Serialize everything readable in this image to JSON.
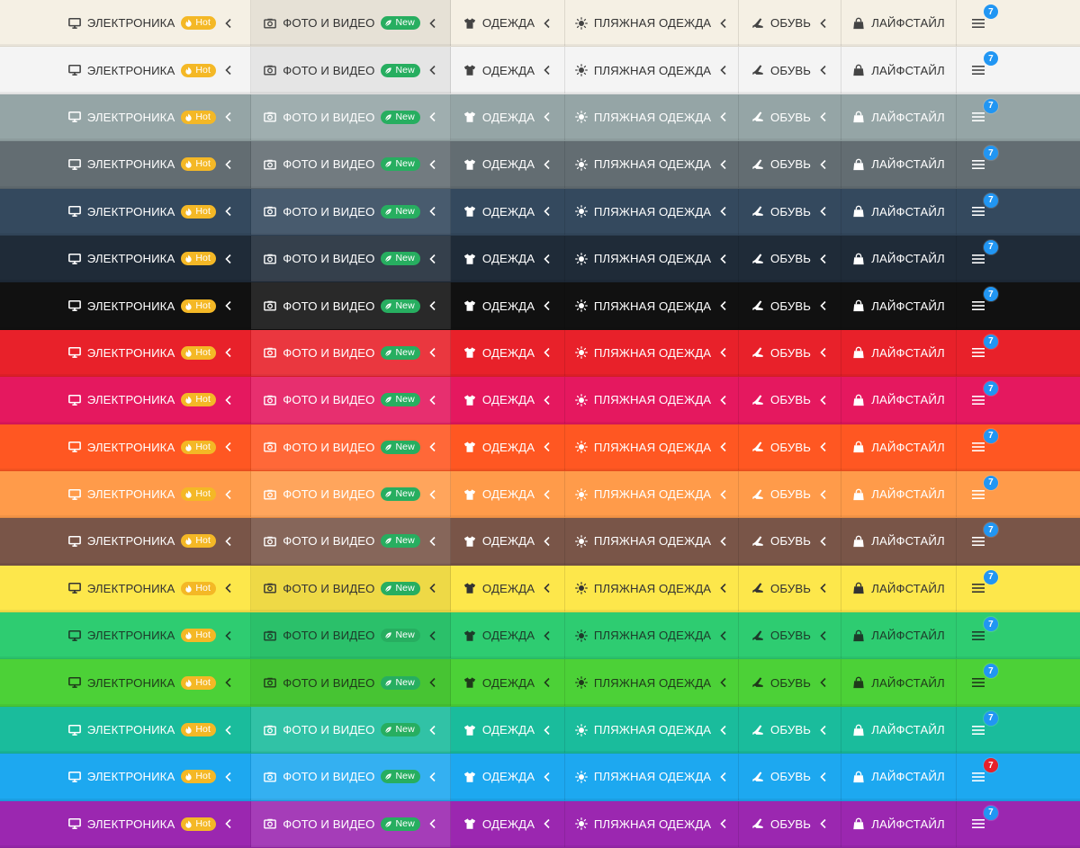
{
  "menu": {
    "items": [
      {
        "id": "elec",
        "label": "ЭЛЕКТРОНИКА",
        "icon": "monitor-icon",
        "badge": {
          "text": "Hot",
          "kind": "hot",
          "icon": "fire-icon"
        },
        "submenu": true
      },
      {
        "id": "foto",
        "label": "ФОТО И ВИДЕО",
        "icon": "camera-icon",
        "badge": {
          "text": "New",
          "kind": "new",
          "icon": "leaf-icon"
        },
        "submenu": true,
        "active": true
      },
      {
        "id": "odez",
        "label": "ОДЕЖДА",
        "icon": "tshirt-icon",
        "submenu": true
      },
      {
        "id": "plaj",
        "label": "ПЛЯЖНАЯ ОДЕЖДА",
        "icon": "sun-icon",
        "submenu": true
      },
      {
        "id": "obuv",
        "label": "ОБУВЬ",
        "icon": "high-heel-icon",
        "submenu": true
      },
      {
        "id": "life",
        "label": "ЛАЙФСТАЙЛ",
        "icon": "shopping-bag-icon",
        "submenu": false
      }
    ],
    "hamburger": {
      "icon": "hamburger-icon",
      "count": "7"
    }
  },
  "themes": [
    {
      "name": "cream",
      "bg": "#f5f0e4",
      "text": "#333333",
      "icon": "#444444",
      "tone": "light"
    },
    {
      "name": "white",
      "bg": "#f4f4f4",
      "text": "#333333",
      "icon": "#444444",
      "tone": "light"
    },
    {
      "name": "gray",
      "bg": "#95a5a6",
      "text": "#ffffff",
      "icon": "#ffffff",
      "tone": "dark"
    },
    {
      "name": "asbestos",
      "bg": "#636d72",
      "text": "#ffffff",
      "icon": "#ffffff",
      "tone": "dark"
    },
    {
      "name": "navy",
      "bg": "#34495e",
      "text": "#ffffff",
      "icon": "#ffffff",
      "tone": "dark"
    },
    {
      "name": "midnight",
      "bg": "#1f2b38",
      "text": "#ffffff",
      "icon": "#ffffff",
      "tone": "dark"
    },
    {
      "name": "black",
      "bg": "#111111",
      "text": "#ffffff",
      "icon": "#ffffff",
      "tone": "dark"
    },
    {
      "name": "red",
      "bg": "#e8212a",
      "text": "#ffffff",
      "icon": "#ffffff",
      "tone": "dark"
    },
    {
      "name": "pink",
      "bg": "#e5185f",
      "text": "#ffffff",
      "icon": "#ffffff",
      "tone": "dark"
    },
    {
      "name": "orange-red",
      "bg": "#ff5722",
      "text": "#ffffff",
      "icon": "#ffffff",
      "tone": "dark"
    },
    {
      "name": "orange",
      "bg": "#ff9b4a",
      "text": "#ffffff",
      "icon": "#ffffff",
      "tone": "dark"
    },
    {
      "name": "brown",
      "bg": "#795548",
      "text": "#ffffff",
      "icon": "#ffffff",
      "tone": "dark"
    },
    {
      "name": "yellow",
      "bg": "#fde74b",
      "text": "#333333",
      "icon": "#333333",
      "tone": "light"
    },
    {
      "name": "green",
      "bg": "#2ecc71",
      "text": "#1d3b2a",
      "icon": "#1d3b2a",
      "tone": "light"
    },
    {
      "name": "lime",
      "bg": "#4cd137",
      "text": "#1f3a1a",
      "icon": "#1f3a1a",
      "tone": "light"
    },
    {
      "name": "teal",
      "bg": "#1abc9c",
      "text": "#ffffff",
      "icon": "#ffffff",
      "tone": "dark"
    },
    {
      "name": "blue",
      "bg": "#1da8f0",
      "text": "#ffffff",
      "icon": "#ffffff",
      "tone": "dark",
      "count_bg": "#e8212a"
    },
    {
      "name": "purple",
      "bg": "#9b27b0",
      "text": "#ffffff",
      "icon": "#ffffff",
      "tone": "dark"
    }
  ]
}
